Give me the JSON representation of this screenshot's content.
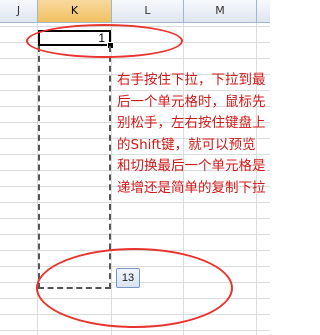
{
  "columns": [
    {
      "label": "J",
      "selected": false
    },
    {
      "label": "K",
      "selected": true
    },
    {
      "label": "L",
      "selected": false
    },
    {
      "label": "M",
      "selected": false
    }
  ],
  "active_cell": {
    "value": "1"
  },
  "annotation_text": "右手按住下拉，下拉到最后一个单元格时，鼠标先别松手，左右按住键盘上的Shift键，就可以预览和切换最后一个单元格是递增还是简单的复制下拉",
  "autofill_badge": "13",
  "colors": {
    "annotation": "#d01818",
    "ellipse": "#e8332e",
    "selected_header": "#f1c15f"
  }
}
